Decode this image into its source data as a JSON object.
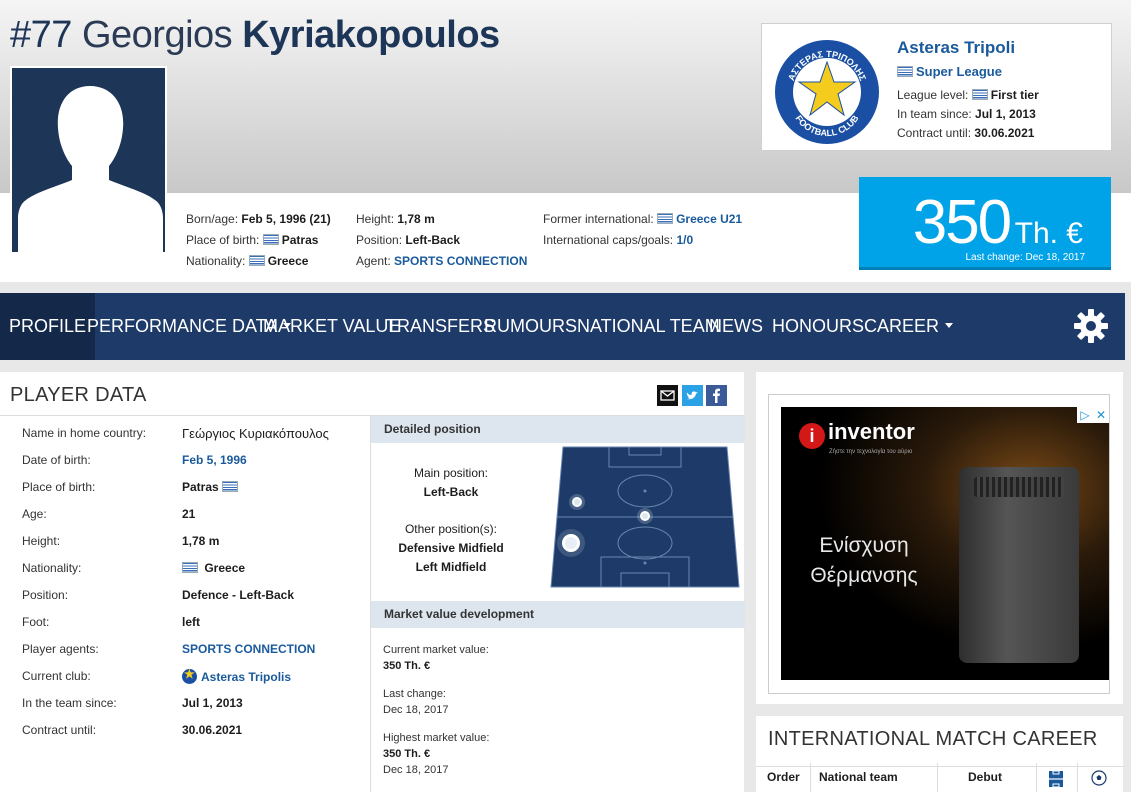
{
  "player": {
    "number": "#77",
    "first_name": "Georgios",
    "last_name": "Kyriakopoulos"
  },
  "header_info": {
    "col1": [
      {
        "label": "Born/age:",
        "value": "Feb 5, 1996 (21)"
      },
      {
        "label": "Place of birth:",
        "value": "Patras"
      },
      {
        "label": "Nationality:",
        "value": "Greece"
      }
    ],
    "col2": [
      {
        "label": "Height:",
        "value": "1,78 m"
      },
      {
        "label": "Position:",
        "value": "Left-Back"
      },
      {
        "label": "Agent:",
        "value": "SPORTS CONNECTION"
      }
    ],
    "col3": [
      {
        "label": "Former international:",
        "value": "Greece U21"
      },
      {
        "label": "International caps/goals:",
        "value": "1/0"
      }
    ]
  },
  "club": {
    "name": "Asteras Tripoli",
    "league": "Super League",
    "logo_top_text": "ΑΣΤΕΡΑΣ ΤΡΙΠΟΛΗΣ",
    "logo_bottom_text": "FOOTBALL CLUB",
    "lines": [
      {
        "label": "League level:",
        "value": "First tier"
      },
      {
        "label": "In team since:",
        "value": "Jul 1, 2013"
      },
      {
        "label": "Contract until:",
        "value": "30.06.2021"
      }
    ]
  },
  "market_value": {
    "amount": "350",
    "unit": "Th. €",
    "last_change": "Last change: Dec 18, 2017"
  },
  "nav": {
    "items": [
      "PROFILE",
      "PERFORMANCE DATA",
      "MARKET VALUE",
      "TRANSFERS",
      "RUMOURS",
      "NATIONAL TEAM",
      "NEWS",
      "HONOURS",
      "CAREER"
    ]
  },
  "player_data": {
    "title": "PLAYER DATA",
    "rows": [
      {
        "label": "Name in home country:",
        "value": "Γεώργιος Κυριακόπουλος"
      },
      {
        "label": "Date of birth:",
        "value": "Feb 5, 1996"
      },
      {
        "label": "Place of birth:",
        "value": "Patras"
      },
      {
        "label": "Age:",
        "value": "21"
      },
      {
        "label": "Height:",
        "value": "1,78 m"
      },
      {
        "label": "Nationality:",
        "value": "Greece"
      },
      {
        "label": "Position:",
        "value": "Defence - Left-Back"
      },
      {
        "label": "Foot:",
        "value": "left"
      },
      {
        "label": "Player agents:",
        "value": "SPORTS CONNECTION"
      },
      {
        "label": "Current club:",
        "value": "Asteras Tripolis"
      },
      {
        "label": "In the team since:",
        "value": "Jul 1, 2013"
      },
      {
        "label": "Contract until:",
        "value": "30.06.2021"
      }
    ]
  },
  "detailed_position": {
    "title": "Detailed position",
    "main_label": "Main position:",
    "main_value": "Left-Back",
    "other_label": "Other position(s):",
    "other_values": [
      "Defensive Midfield",
      "Left Midfield"
    ]
  },
  "mv_development": {
    "title": "Market value development",
    "current_label": "Current market value:",
    "current_value": "350 Th. €",
    "last_change_label": "Last change:",
    "last_change_value": "Dec 18, 2017",
    "highest_label": "Highest market value:",
    "highest_value": "350 Th. €",
    "highest_date": "Dec 18, 2017"
  },
  "ad": {
    "brand": "inventor",
    "tagline": "Ζήστε την τεχνολογία του αύριο",
    "text_line1": "Ενίσχυση",
    "text_line2": "Θέρμανσης"
  },
  "international_career": {
    "title": "INTERNATIONAL MATCH CAREER",
    "columns": [
      "Order",
      "National team",
      "Debut"
    ]
  },
  "colors": {
    "navy": "#1d3a68",
    "link": "#1a5a9c",
    "market_value_bg": "#00a2e8"
  }
}
